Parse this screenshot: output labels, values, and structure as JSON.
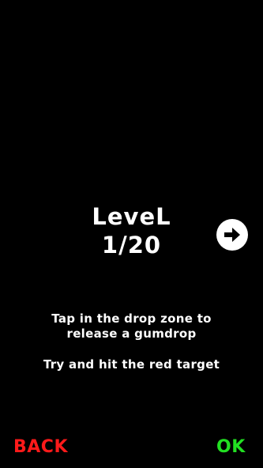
{
  "level": {
    "label": "LeveL",
    "progress": "1/20"
  },
  "next_button": {
    "icon": "arrow-right-icon"
  },
  "instructions": {
    "line1": "Tap in the drop zone to release a gumdrop",
    "line2": "Try and hit the red target"
  },
  "footer": {
    "back_label": "BACK",
    "ok_label": "OK"
  },
  "colors": {
    "background": "#000000",
    "text": "#ffffff",
    "back": "#ff1a1a",
    "ok": "#22e022"
  }
}
